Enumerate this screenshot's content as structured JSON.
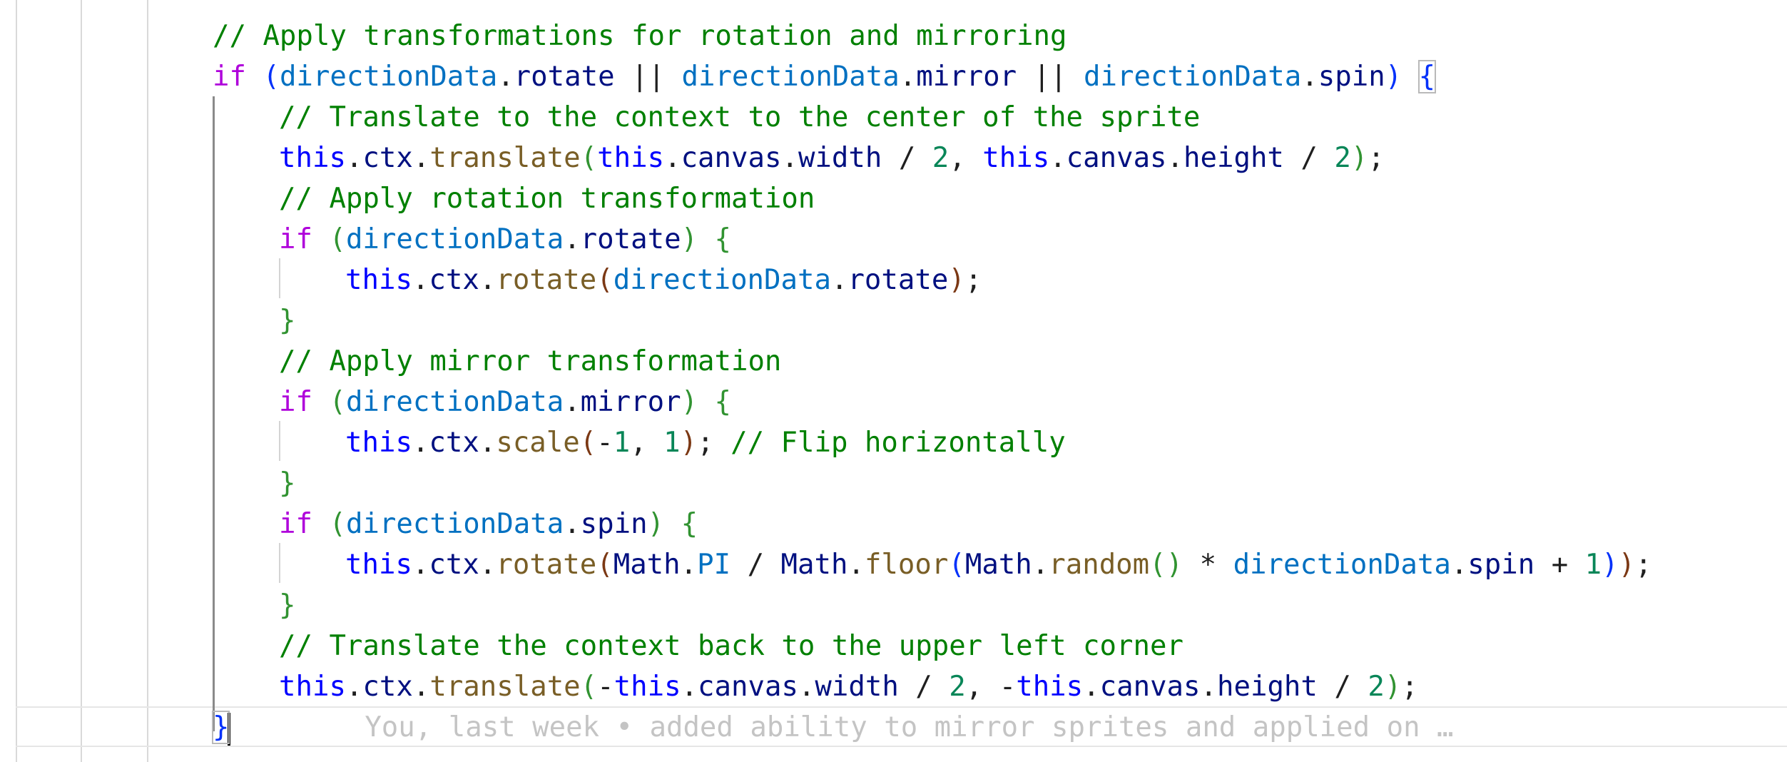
{
  "editor": {
    "lines": [
      {
        "indent": 0,
        "tokens": [
          {
            "t": "// Apply transformations for rotation and mirroring",
            "c": "cmt"
          }
        ]
      },
      {
        "indent": 0,
        "tokens": [
          {
            "t": "if",
            "c": "kw-ctrl"
          },
          {
            "t": " ",
            "c": "punc"
          },
          {
            "t": "(",
            "c": "p1"
          },
          {
            "t": "directionData",
            "c": "var"
          },
          {
            "t": ".",
            "c": "punc"
          },
          {
            "t": "rotate",
            "c": "prop"
          },
          {
            "t": " || ",
            "c": "punc"
          },
          {
            "t": "directionData",
            "c": "var"
          },
          {
            "t": ".",
            "c": "punc"
          },
          {
            "t": "mirror",
            "c": "prop"
          },
          {
            "t": " || ",
            "c": "punc"
          },
          {
            "t": "directionData",
            "c": "var"
          },
          {
            "t": ".",
            "c": "punc"
          },
          {
            "t": "spin",
            "c": "prop"
          },
          {
            "t": ")",
            "c": "p1"
          },
          {
            "t": " ",
            "c": "punc"
          },
          {
            "t": "{",
            "c": "p1 bracket-box"
          }
        ]
      },
      {
        "indent": 1,
        "tokens": [
          {
            "t": "// Translate to the context to the center of the sprite",
            "c": "cmt"
          }
        ]
      },
      {
        "indent": 1,
        "tokens": [
          {
            "t": "this",
            "c": "kw"
          },
          {
            "t": ".",
            "c": "punc"
          },
          {
            "t": "ctx",
            "c": "prop"
          },
          {
            "t": ".",
            "c": "punc"
          },
          {
            "t": "translate",
            "c": "fn"
          },
          {
            "t": "(",
            "c": "p2"
          },
          {
            "t": "this",
            "c": "kw"
          },
          {
            "t": ".",
            "c": "punc"
          },
          {
            "t": "canvas",
            "c": "prop"
          },
          {
            "t": ".",
            "c": "punc"
          },
          {
            "t": "width",
            "c": "prop"
          },
          {
            "t": " / ",
            "c": "punc"
          },
          {
            "t": "2",
            "c": "num"
          },
          {
            "t": ", ",
            "c": "punc"
          },
          {
            "t": "this",
            "c": "kw"
          },
          {
            "t": ".",
            "c": "punc"
          },
          {
            "t": "canvas",
            "c": "prop"
          },
          {
            "t": ".",
            "c": "punc"
          },
          {
            "t": "height",
            "c": "prop"
          },
          {
            "t": " / ",
            "c": "punc"
          },
          {
            "t": "2",
            "c": "num"
          },
          {
            "t": ")",
            "c": "p2"
          },
          {
            "t": ";",
            "c": "punc"
          }
        ]
      },
      {
        "indent": 1,
        "tokens": [
          {
            "t": "// Apply rotation transformation",
            "c": "cmt"
          }
        ]
      },
      {
        "indent": 1,
        "tokens": [
          {
            "t": "if",
            "c": "kw-ctrl"
          },
          {
            "t": " ",
            "c": "punc"
          },
          {
            "t": "(",
            "c": "p2"
          },
          {
            "t": "directionData",
            "c": "var"
          },
          {
            "t": ".",
            "c": "punc"
          },
          {
            "t": "rotate",
            "c": "prop"
          },
          {
            "t": ")",
            "c": "p2"
          },
          {
            "t": " ",
            "c": "punc"
          },
          {
            "t": "{",
            "c": "p2"
          }
        ]
      },
      {
        "indent": 2,
        "tokens": [
          {
            "t": "this",
            "c": "kw"
          },
          {
            "t": ".",
            "c": "punc"
          },
          {
            "t": "ctx",
            "c": "prop"
          },
          {
            "t": ".",
            "c": "punc"
          },
          {
            "t": "rotate",
            "c": "fn"
          },
          {
            "t": "(",
            "c": "p3"
          },
          {
            "t": "directionData",
            "c": "var"
          },
          {
            "t": ".",
            "c": "punc"
          },
          {
            "t": "rotate",
            "c": "prop"
          },
          {
            "t": ")",
            "c": "p3"
          },
          {
            "t": ";",
            "c": "punc"
          }
        ]
      },
      {
        "indent": 1,
        "tokens": [
          {
            "t": "}",
            "c": "p2"
          }
        ]
      },
      {
        "indent": 1,
        "tokens": [
          {
            "t": "// Apply mirror transformation",
            "c": "cmt"
          }
        ]
      },
      {
        "indent": 1,
        "tokens": [
          {
            "t": "if",
            "c": "kw-ctrl"
          },
          {
            "t": " ",
            "c": "punc"
          },
          {
            "t": "(",
            "c": "p2"
          },
          {
            "t": "directionData",
            "c": "var"
          },
          {
            "t": ".",
            "c": "punc"
          },
          {
            "t": "mirror",
            "c": "prop"
          },
          {
            "t": ")",
            "c": "p2"
          },
          {
            "t": " ",
            "c": "punc"
          },
          {
            "t": "{",
            "c": "p2"
          }
        ]
      },
      {
        "indent": 2,
        "tokens": [
          {
            "t": "this",
            "c": "kw"
          },
          {
            "t": ".",
            "c": "punc"
          },
          {
            "t": "ctx",
            "c": "prop"
          },
          {
            "t": ".",
            "c": "punc"
          },
          {
            "t": "scale",
            "c": "fn"
          },
          {
            "t": "(",
            "c": "p3"
          },
          {
            "t": "-",
            "c": "punc"
          },
          {
            "t": "1",
            "c": "num"
          },
          {
            "t": ", ",
            "c": "punc"
          },
          {
            "t": "1",
            "c": "num"
          },
          {
            "t": ")",
            "c": "p3"
          },
          {
            "t": "; ",
            "c": "punc"
          },
          {
            "t": "// Flip horizontally",
            "c": "cmt"
          }
        ]
      },
      {
        "indent": 1,
        "tokens": [
          {
            "t": "}",
            "c": "p2"
          }
        ]
      },
      {
        "indent": 1,
        "tokens": [
          {
            "t": "if",
            "c": "kw-ctrl"
          },
          {
            "t": " ",
            "c": "punc"
          },
          {
            "t": "(",
            "c": "p2"
          },
          {
            "t": "directionData",
            "c": "var"
          },
          {
            "t": ".",
            "c": "punc"
          },
          {
            "t": "spin",
            "c": "prop"
          },
          {
            "t": ")",
            "c": "p2"
          },
          {
            "t": " ",
            "c": "punc"
          },
          {
            "t": "{",
            "c": "p2"
          }
        ]
      },
      {
        "indent": 2,
        "tokens": [
          {
            "t": "this",
            "c": "kw"
          },
          {
            "t": ".",
            "c": "punc"
          },
          {
            "t": "ctx",
            "c": "prop"
          },
          {
            "t": ".",
            "c": "punc"
          },
          {
            "t": "rotate",
            "c": "fn"
          },
          {
            "t": "(",
            "c": "p3"
          },
          {
            "t": "Math",
            "c": "prop"
          },
          {
            "t": ".",
            "c": "punc"
          },
          {
            "t": "PI",
            "c": "const"
          },
          {
            "t": " / ",
            "c": "punc"
          },
          {
            "t": "Math",
            "c": "prop"
          },
          {
            "t": ".",
            "c": "punc"
          },
          {
            "t": "floor",
            "c": "fn"
          },
          {
            "t": "(",
            "c": "p1"
          },
          {
            "t": "Math",
            "c": "prop"
          },
          {
            "t": ".",
            "c": "punc"
          },
          {
            "t": "random",
            "c": "fn"
          },
          {
            "t": "()",
            "c": "p2"
          },
          {
            "t": " * ",
            "c": "punc"
          },
          {
            "t": "directionData",
            "c": "var"
          },
          {
            "t": ".",
            "c": "punc"
          },
          {
            "t": "spin",
            "c": "prop"
          },
          {
            "t": " + ",
            "c": "punc"
          },
          {
            "t": "1",
            "c": "num"
          },
          {
            "t": ")",
            "c": "p1"
          },
          {
            "t": ")",
            "c": "p3"
          },
          {
            "t": ";",
            "c": "punc"
          }
        ]
      },
      {
        "indent": 1,
        "tokens": [
          {
            "t": "}",
            "c": "p2"
          }
        ]
      },
      {
        "indent": 1,
        "tokens": [
          {
            "t": "// Translate the context back to the upper left corner",
            "c": "cmt"
          }
        ]
      },
      {
        "indent": 1,
        "tokens": [
          {
            "t": "this",
            "c": "kw"
          },
          {
            "t": ".",
            "c": "punc"
          },
          {
            "t": "ctx",
            "c": "prop"
          },
          {
            "t": ".",
            "c": "punc"
          },
          {
            "t": "translate",
            "c": "fn"
          },
          {
            "t": "(",
            "c": "p2"
          },
          {
            "t": "-",
            "c": "punc"
          },
          {
            "t": "this",
            "c": "kw"
          },
          {
            "t": ".",
            "c": "punc"
          },
          {
            "t": "canvas",
            "c": "prop"
          },
          {
            "t": ".",
            "c": "punc"
          },
          {
            "t": "width",
            "c": "prop"
          },
          {
            "t": " / ",
            "c": "punc"
          },
          {
            "t": "2",
            "c": "num"
          },
          {
            "t": ", ",
            "c": "punc"
          },
          {
            "t": "-",
            "c": "punc"
          },
          {
            "t": "this",
            "c": "kw"
          },
          {
            "t": ".",
            "c": "punc"
          },
          {
            "t": "canvas",
            "c": "prop"
          },
          {
            "t": ".",
            "c": "punc"
          },
          {
            "t": "height",
            "c": "prop"
          },
          {
            "t": " / ",
            "c": "punc"
          },
          {
            "t": "2",
            "c": "num"
          },
          {
            "t": ")",
            "c": "p2"
          },
          {
            "t": ";",
            "c": "punc"
          }
        ]
      },
      {
        "indent": 0,
        "current": true,
        "tokens": [
          {
            "t": "}",
            "c": "p1 bracket-box"
          }
        ]
      }
    ],
    "blame_annotation": "You, last week • added ability to mirror sprites and applied on …"
  }
}
